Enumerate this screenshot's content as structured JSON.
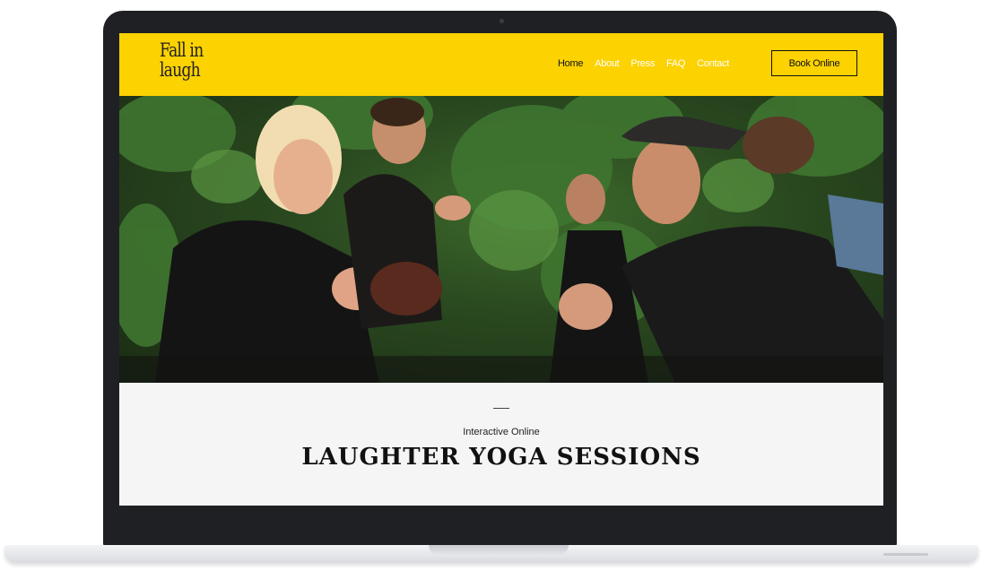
{
  "site": {
    "logo_line1": "Fall in",
    "logo_line2": "laugh"
  },
  "nav": {
    "items": [
      {
        "label": "Home",
        "active": true
      },
      {
        "label": "About",
        "active": false
      },
      {
        "label": "Press",
        "active": false
      },
      {
        "label": "FAQ",
        "active": false
      },
      {
        "label": "Contact",
        "active": false
      }
    ],
    "book_label": "Book Online"
  },
  "hero": {
    "image": "people-laughing-in-garden-photo"
  },
  "intro": {
    "subtitle": "Interactive Online",
    "title": "LAUGHTER YOGA SESSIONS"
  },
  "colors": {
    "accent": "#fcd200",
    "frame": "#1f2024"
  }
}
